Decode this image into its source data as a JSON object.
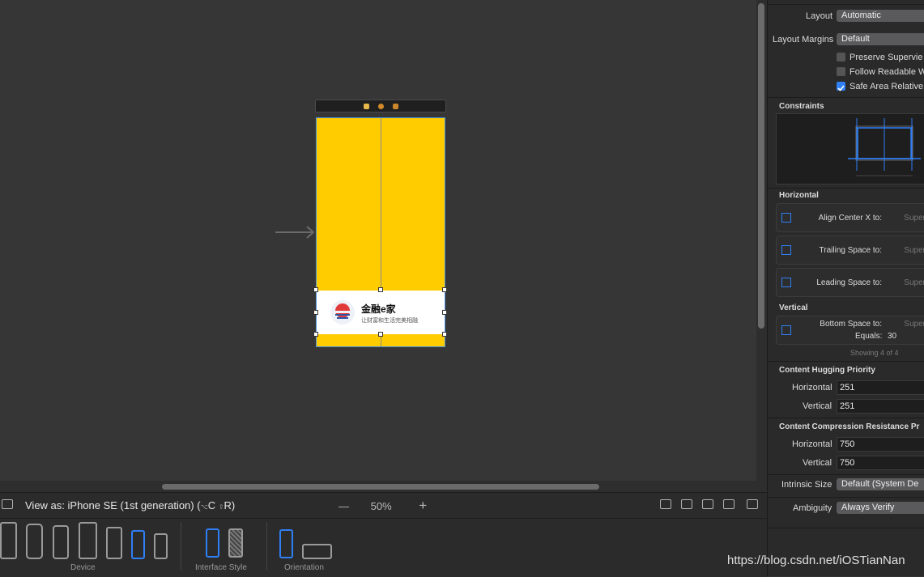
{
  "canvas": {
    "scene_bar_dot_colors": [
      "#e7b94a",
      "#d28a2a",
      "#c9862a"
    ],
    "screen_color": "#ffcc00",
    "banner": {
      "title": "金融e家",
      "subtitle": "让财富和生活完美相融"
    }
  },
  "bottombar": {
    "view_as": "View as: iPhone SE (1st generation)",
    "view_as_shortcut_open": "(",
    "shortcut_key1": "⌥",
    "shortcut_letter1": "C",
    "shortcut_key2": "⇧",
    "shortcut_letter2": "R",
    "view_as_shortcut_close": ")",
    "zoom_out": "—",
    "zoom_level": "50%",
    "zoom_in": "+",
    "group_device": "Device",
    "group_interface_style": "Interface Style",
    "group_orientation": "Orientation"
  },
  "inspector": {
    "layout_label": "Layout",
    "layout_value": "Automatic",
    "layout_margins_label": "Layout Margins",
    "layout_margins_value": "Default",
    "checkboxes": [
      {
        "label": "Preserve Supervie",
        "checked": false
      },
      {
        "label": "Follow Readable W",
        "checked": false
      },
      {
        "label": "Safe Area Relative",
        "checked": true
      }
    ],
    "constraints_title": "Constraints",
    "horizontal_title": "Horizontal",
    "horizontal_items": [
      {
        "label": "Align Center X to:",
        "target": "Superview"
      },
      {
        "label": "Trailing Space to:",
        "target": "Superview"
      },
      {
        "label": "Leading Space to:",
        "target": "Superview"
      }
    ],
    "vertical_title": "Vertical",
    "vertical_item": {
      "label": "Bottom Space to:",
      "target": "Superview",
      "equals_label": "Equals:",
      "equals_value": "30"
    },
    "showing": "Showing 4 of 4",
    "hugging_title": "Content Hugging Priority",
    "hugging_horizontal_label": "Horizontal",
    "hugging_horizontal_value": "251",
    "hugging_vertical_label": "Vertical",
    "hugging_vertical_value": "251",
    "compression_title": "Content Compression Resistance Pr",
    "compression_horizontal_label": "Horizontal",
    "compression_horizontal_value": "750",
    "compression_vertical_label": "Vertical",
    "compression_vertical_value": "750",
    "intrinsic_label": "Intrinsic Size",
    "intrinsic_value": "Default (System De",
    "ambiguity_label": "Ambiguity",
    "ambiguity_value": "Always Verify"
  },
  "watermark": "https://blog.csdn.net/iOSTianNan",
  "accent_color": "#2f7ff5"
}
